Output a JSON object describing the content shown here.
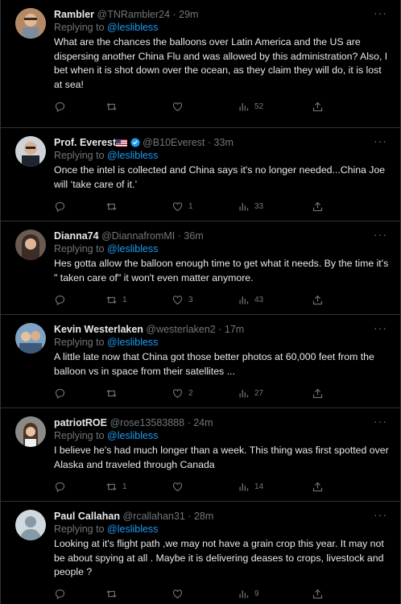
{
  "replying_label": "Replying to",
  "more_label": "···",
  "tweets": [
    {
      "name": "Rambler",
      "handle": "@TNRambler24",
      "time": "29m",
      "reply_to": "@leslibless",
      "text": "What are the chances the balloons over Latin America and the US are dispersing another China Flu and was allowed by this administration? Also, I bet when it is shot down over the ocean, as they claim they will do, it is lost at sea!",
      "replies": "",
      "retweets": "",
      "likes": "",
      "views": "52"
    },
    {
      "name": "Prof. Everest",
      "handle": "@B10Everest",
      "time": "33m",
      "reply_to": "@leslibless",
      "text": "Once the intel is collected and China says it's no longer needed...China Joe will ‘take care of it.’",
      "replies": "",
      "retweets": "",
      "likes": "1",
      "views": "33"
    },
    {
      "name": "Dianna74",
      "handle": "@DiannafromMI",
      "time": "36m",
      "reply_to": "@leslibless",
      "text": "Hes gotta allow the balloon enough time to get what it needs. By the time it's \" taken care of\" it won't even matter anymore.",
      "replies": "",
      "retweets": "1",
      "likes": "3",
      "views": "43"
    },
    {
      "name": "Kevin Westerlaken",
      "handle": "@westerlaken2",
      "time": "17m",
      "reply_to": "@leslibless",
      "text": "A little late now that China got those better photos at 60,000 feet from the balloon vs in space from their satellites ...",
      "replies": "",
      "retweets": "",
      "likes": "2",
      "views": "27"
    },
    {
      "name": "patriotROE",
      "handle": "@rose13583888",
      "time": "24m",
      "reply_to": "@leslibless",
      "text": "I believe he's had much longer than a week.   This thing was first spotted over Alaska and traveled through Canada",
      "replies": "",
      "retweets": "1",
      "likes": "",
      "views": "14"
    },
    {
      "name": "Paul Callahan",
      "handle": "@rcallahan31",
      "time": "28m",
      "reply_to": "@leslibless",
      "text": "Looking at it's flight path ,we may not have a grain crop this year. It may not be about spying at all . Maybe it is delivering deases to crops, livestock and people ?",
      "replies": "",
      "retweets": "",
      "likes": "",
      "views": "9"
    }
  ]
}
